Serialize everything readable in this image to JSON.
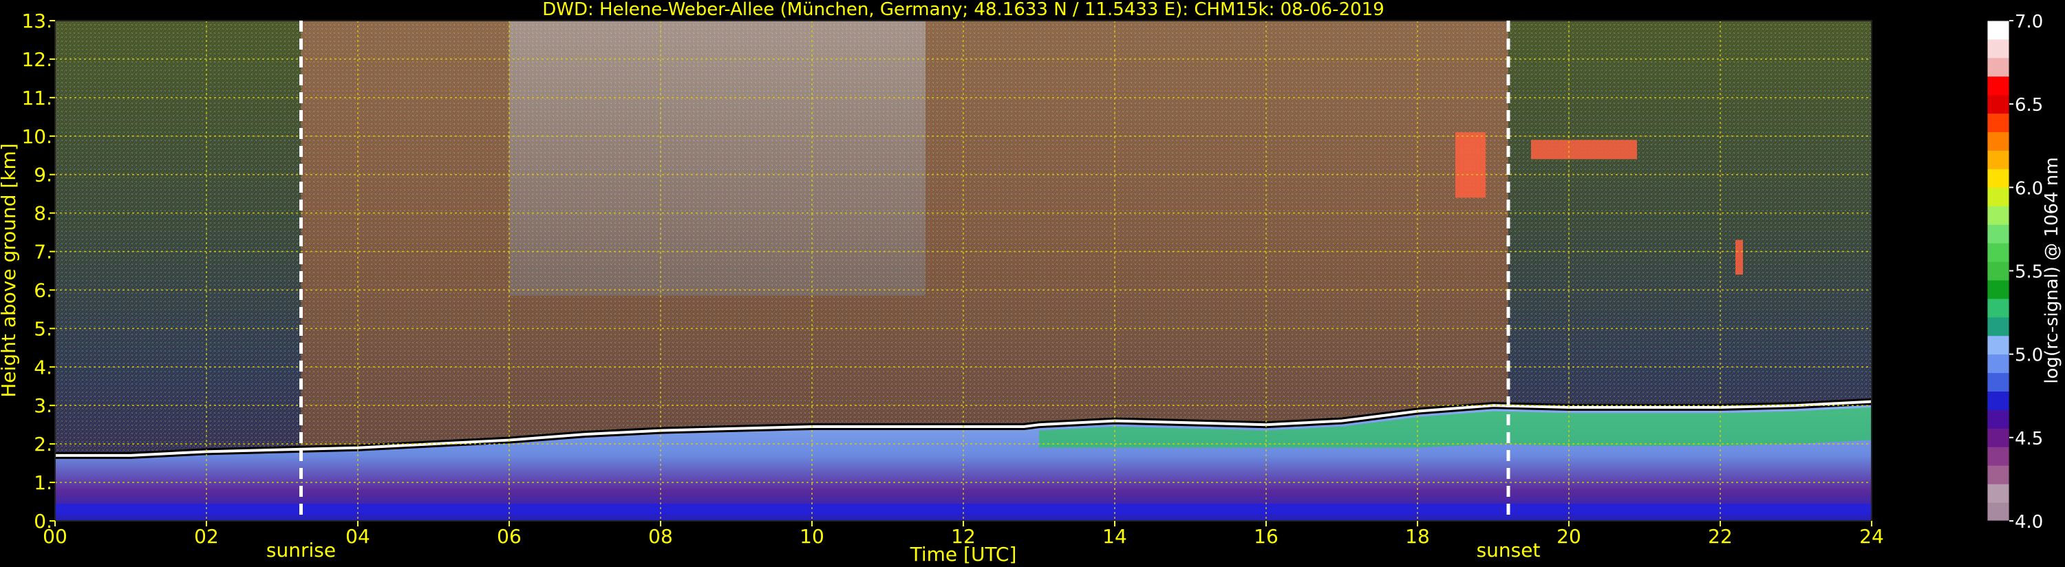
{
  "chart_data": {
    "type": "heatmap",
    "title": "DWD: Helene-Weber-Allee (München, Germany; 48.1633 N / 11.5433 E):    CHM15k: 08-06-2019",
    "xlabel": "Time [UTC]",
    "ylabel": "Height above ground [km]",
    "x_ticks": [
      "00",
      "02",
      "04",
      "06",
      "08",
      "10",
      "12",
      "14",
      "16",
      "18",
      "20",
      "22",
      "24"
    ],
    "y_ticks": [
      "0.",
      "1.",
      "2.",
      "3.",
      "4.",
      "5.",
      "6.",
      "7.",
      "8.",
      "9.",
      "10.",
      "11.",
      "12.",
      "13."
    ],
    "xlim": [
      0,
      24
    ],
    "ylim": [
      0,
      13
    ],
    "grid": true,
    "annotations": [
      {
        "label": "sunrise",
        "time": 3.25
      },
      {
        "label": "sunset",
        "time": 19.2
      }
    ],
    "colorbar": {
      "label": "log(rc-signal) @ 1064 nm",
      "range": [
        4.0,
        7.0
      ],
      "ticks": [
        "4.0",
        "4.5",
        "5.0",
        "5.5",
        "6.0",
        "6.5",
        "7.0"
      ],
      "colors": [
        "#a88aa0",
        "#b69aae",
        "#a06090",
        "#8a3a8a",
        "#6a1a8a",
        "#4a10a0",
        "#2020d0",
        "#4060e0",
        "#6a90f0",
        "#90b8f8",
        "#20a080",
        "#30c070",
        "#10a020",
        "#40c040",
        "#50d050",
        "#70e070",
        "#a0f060",
        "#d0f020",
        "#ffe000",
        "#ffb000",
        "#ff8000",
        "#ff4000",
        "#e00000",
        "#ff0000",
        "#f0b0b0",
        "#f8d8d8",
        "#ffffff"
      ]
    },
    "boundary_layer_top": {
      "time": [
        0,
        1,
        2,
        3,
        4,
        5,
        6,
        7,
        8,
        9,
        10,
        11,
        12,
        12.8,
        13,
        14,
        15,
        16,
        17,
        18,
        19,
        20,
        21,
        22,
        23,
        24
      ],
      "height": [
        1.7,
        1.7,
        1.8,
        1.85,
        1.9,
        2.0,
        2.1,
        2.25,
        2.35,
        2.4,
        2.45,
        2.45,
        2.45,
        2.45,
        2.5,
        2.6,
        2.55,
        2.5,
        2.6,
        2.85,
        3.0,
        2.95,
        2.95,
        2.95,
        3.0,
        3.1
      ]
    },
    "cloud_features": [
      {
        "t_start": 18.5,
        "t_end": 18.9,
        "h_low": 8.4,
        "h_high": 10.1
      },
      {
        "t_start": 19.5,
        "t_end": 20.9,
        "h_low": 9.4,
        "h_high": 9.9
      },
      {
        "t_start": 22.2,
        "t_end": 22.3,
        "h_low": 6.4,
        "h_high": 7.3
      }
    ]
  }
}
